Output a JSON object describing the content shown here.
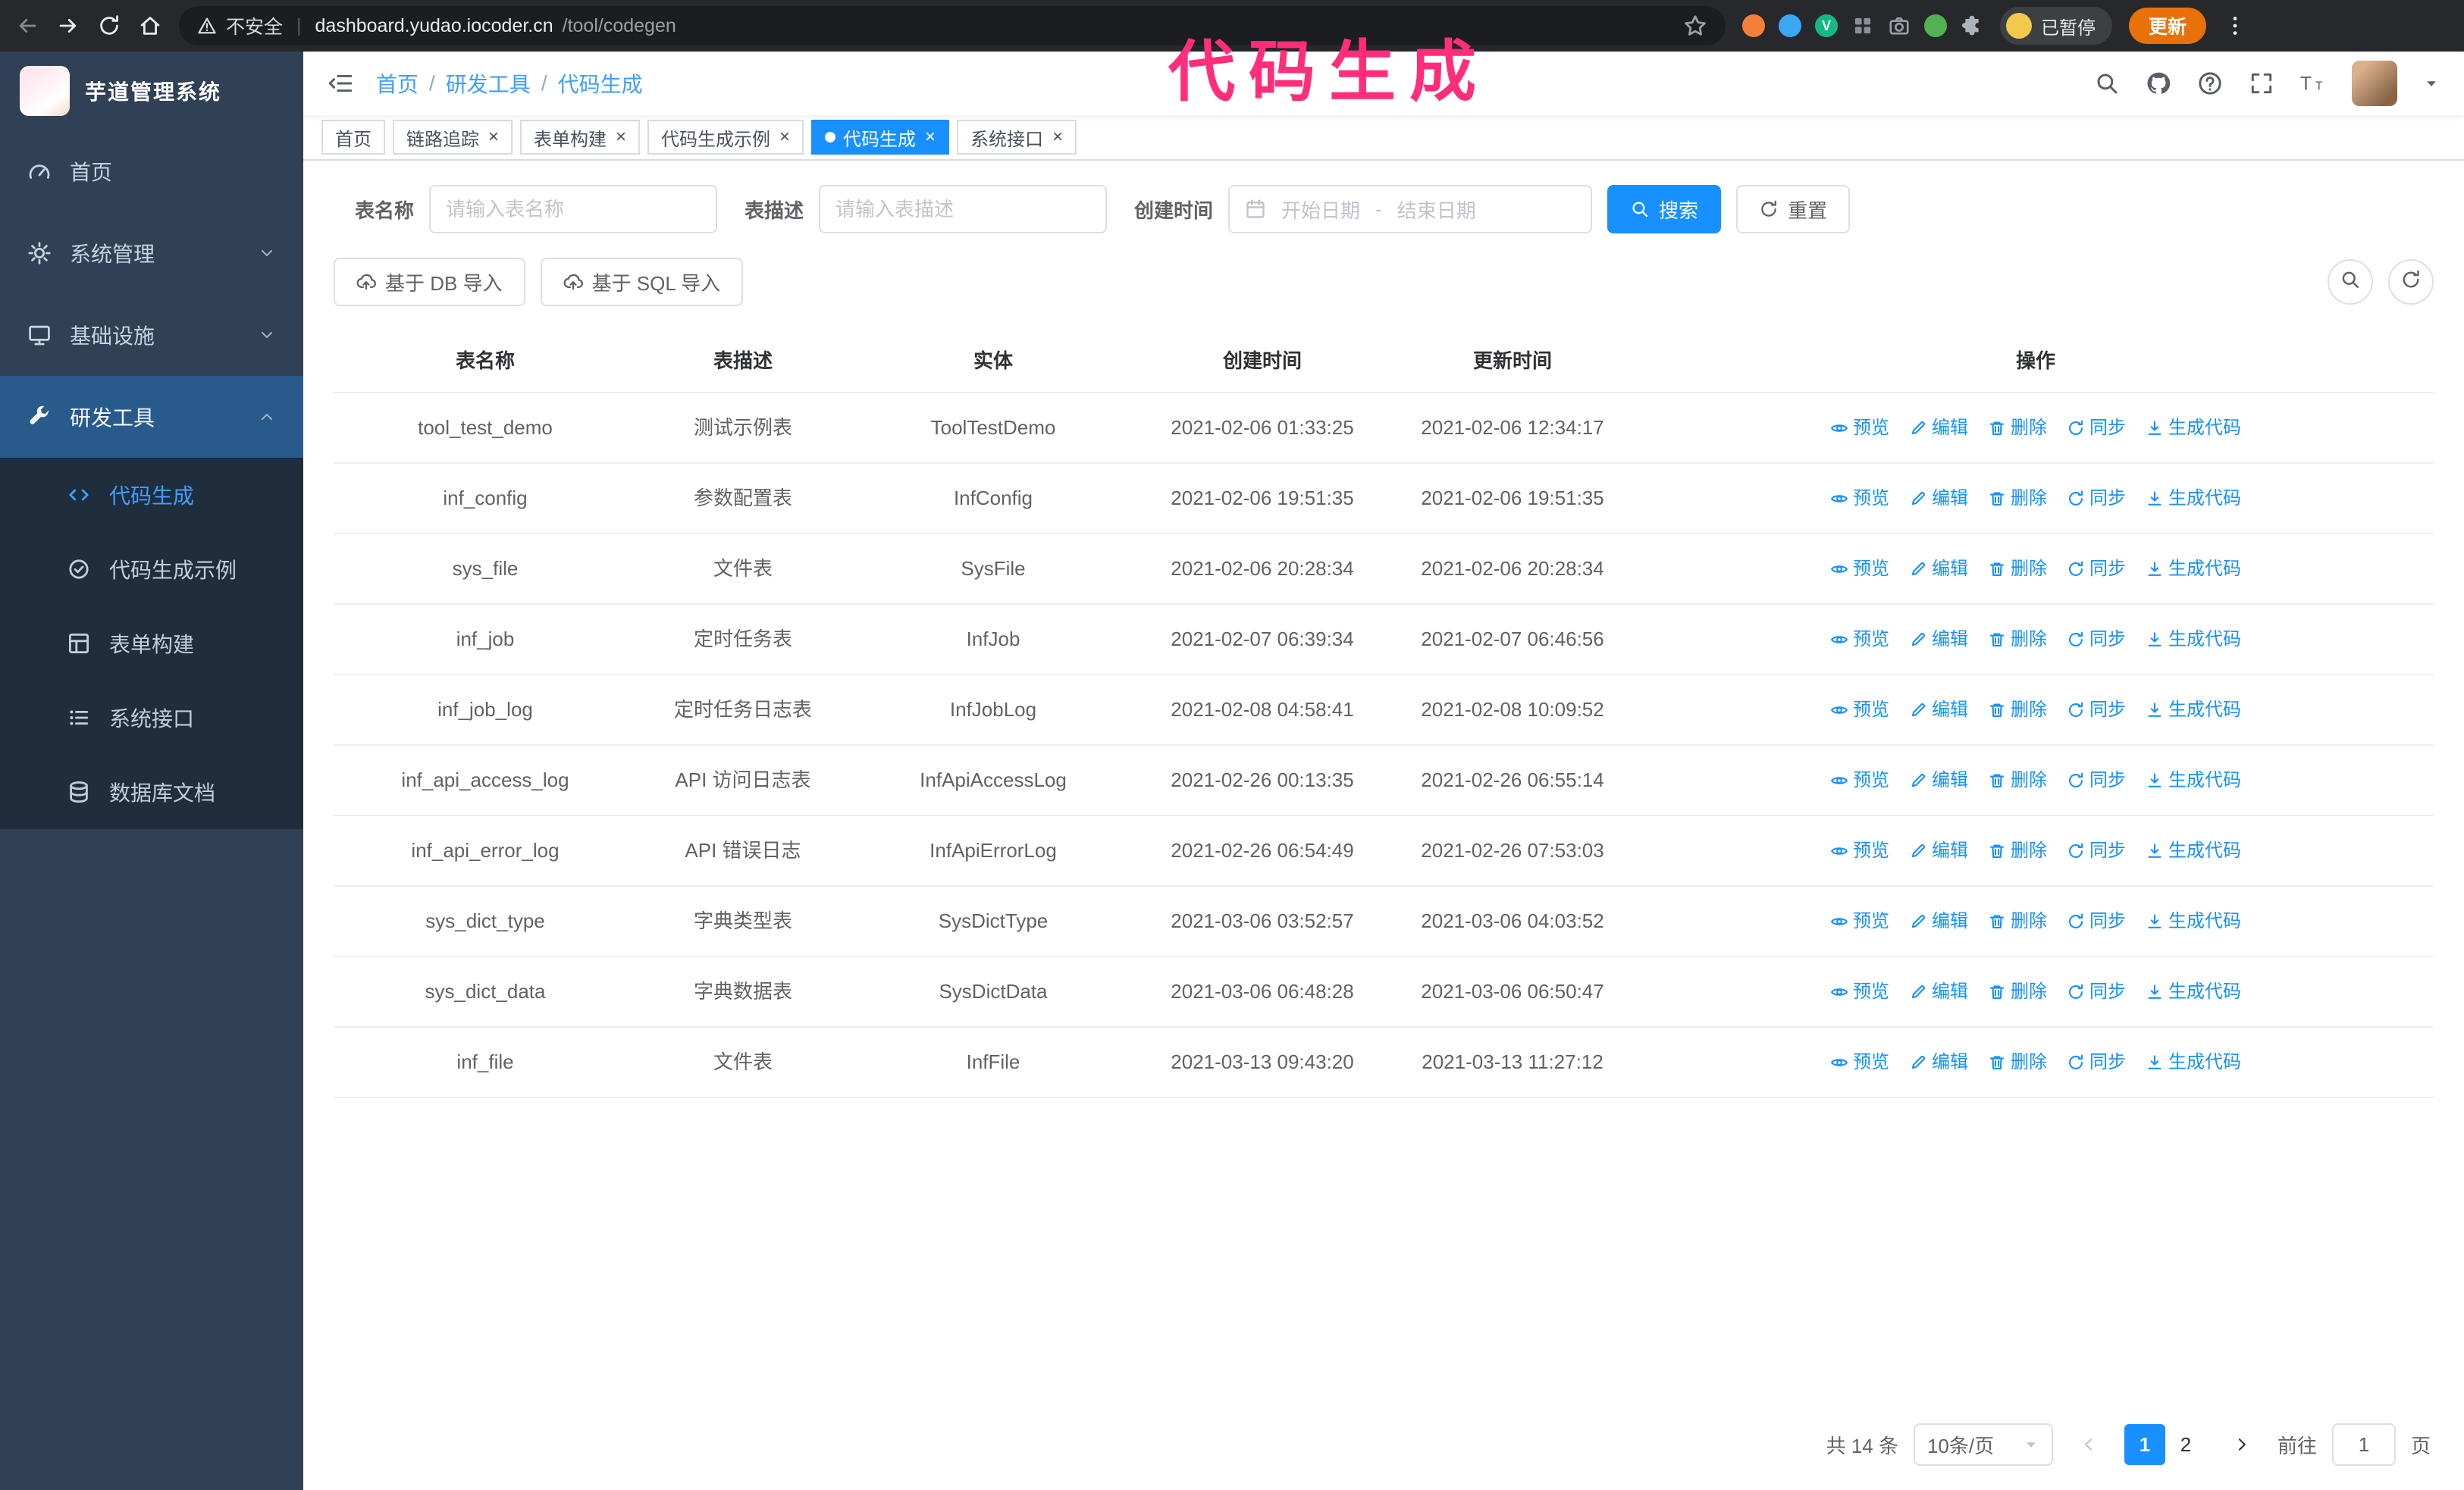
{
  "annotation": {
    "text": "代码生成",
    "color": "#ff2d7a"
  },
  "browser": {
    "security_label": "不安全",
    "url_host": "dashboard.yudao.iocoder.cn",
    "url_path": "/tool/codegen",
    "paused_badge": "已暂停",
    "update_label": "更新",
    "extensions": [
      {
        "id": "extension-1",
        "color": "#f5803a"
      },
      {
        "id": "extension-2",
        "color": "#3aa7f5"
      },
      {
        "id": "extension-3",
        "color": "#12b886",
        "letter": "V"
      },
      {
        "id": "extension-4",
        "glyph": "grid-icon",
        "color": "#8a9097"
      },
      {
        "id": "extension-5",
        "glyph": "camera-icon",
        "color": "#9aa0a6"
      },
      {
        "id": "extension-6",
        "color": "#52b153"
      },
      {
        "id": "extension-7",
        "glyph": "puzzle-icon",
        "color": "#aeb3b9"
      }
    ]
  },
  "colors": {
    "accent": "#1890ff",
    "sidebar_bg": "#304156",
    "submenu_bg": "#1f2d3d",
    "annotation": "#ff2d7a",
    "update_button": "#e8710a",
    "link": "#409eff"
  },
  "sidebar": {
    "logo_title": "芋道管理系统",
    "menu": [
      {
        "id": "home",
        "label": "首页",
        "icon": "dashboard-icon"
      },
      {
        "id": "system",
        "label": "系统管理",
        "icon": "gear-icon",
        "chevron": "down"
      },
      {
        "id": "infra",
        "label": "基础设施",
        "icon": "monitor-icon",
        "chevron": "down"
      },
      {
        "id": "devtools",
        "label": "研发工具",
        "icon": "tools-icon",
        "chevron": "up",
        "active": true,
        "open": true
      }
    ],
    "submenu": [
      {
        "id": "codegen",
        "label": "代码生成",
        "icon": "code-icon",
        "active": true
      },
      {
        "id": "codegen-example",
        "label": "代码生成示例",
        "icon": "example-icon"
      },
      {
        "id": "form-builder",
        "label": "表单构建",
        "icon": "form-icon"
      },
      {
        "id": "api",
        "label": "系统接口",
        "icon": "api-icon"
      },
      {
        "id": "db-doc",
        "label": "数据库文档",
        "icon": "database-icon"
      }
    ]
  },
  "navbar": {
    "breadcrumb": [
      "首页",
      "研发工具",
      "代码生成"
    ]
  },
  "tabs": [
    {
      "id": "home",
      "label": "首页",
      "closable": false,
      "active": false
    },
    {
      "id": "tracer",
      "label": "链路追踪",
      "closable": true,
      "active": false
    },
    {
      "id": "form-builder",
      "label": "表单构建",
      "closable": true,
      "active": false
    },
    {
      "id": "codegen-example",
      "label": "代码生成示例",
      "closable": true,
      "active": false
    },
    {
      "id": "codegen",
      "label": "代码生成",
      "closable": true,
      "active": true
    },
    {
      "id": "api",
      "label": "系统接口",
      "closable": true,
      "active": false
    }
  ],
  "filters": {
    "table_name_label": "表名称",
    "table_name_placeholder": "请输入表名称",
    "table_desc_label": "表描述",
    "table_desc_placeholder": "请输入表描述",
    "create_time_label": "创建时间",
    "date_start_placeholder": "开始日期",
    "date_separator": "-",
    "date_end_placeholder": "结束日期",
    "search_label": "搜索",
    "reset_label": "重置"
  },
  "toolbar": {
    "import_db_label": "基于 DB 导入",
    "import_sql_label": "基于 SQL 导入"
  },
  "table": {
    "columns": [
      "表名称",
      "表描述",
      "实体",
      "创建时间",
      "更新时间",
      "操作"
    ],
    "actions": [
      {
        "id": "preview",
        "label": "预览",
        "icon": "eye-icon"
      },
      {
        "id": "edit",
        "label": "编辑",
        "icon": "edit-icon"
      },
      {
        "id": "delete",
        "label": "删除",
        "icon": "delete-icon"
      },
      {
        "id": "sync",
        "label": "同步",
        "icon": "sync-icon"
      },
      {
        "id": "generate",
        "label": "生成代码",
        "icon": "download-icon"
      }
    ],
    "rows": [
      {
        "name": "tool_test_demo",
        "desc": "测试示例表",
        "entity": "ToolTestDemo",
        "created": "2021-02-06 01:33:25",
        "updated": "2021-02-06 12:34:17"
      },
      {
        "name": "inf_config",
        "desc": "参数配置表",
        "entity": "InfConfig",
        "created": "2021-02-06 19:51:35",
        "updated": "2021-02-06 19:51:35"
      },
      {
        "name": "sys_file",
        "desc": "文件表",
        "entity": "SysFile",
        "created": "2021-02-06 20:28:34",
        "updated": "2021-02-06 20:28:34"
      },
      {
        "name": "inf_job",
        "desc": "定时任务表",
        "entity": "InfJob",
        "created": "2021-02-07 06:39:34",
        "updated": "2021-02-07 06:46:56"
      },
      {
        "name": "inf_job_log",
        "desc": "定时任务日志表",
        "entity": "InfJobLog",
        "created": "2021-02-08 04:58:41",
        "updated": "2021-02-08 10:09:52"
      },
      {
        "name": "inf_api_access_log",
        "desc": "API 访问日志表",
        "entity": "InfApiAccessLog",
        "created": "2021-02-26 00:13:35",
        "updated": "2021-02-26 06:55:14"
      },
      {
        "name": "inf_api_error_log",
        "desc": "API 错误日志",
        "entity": "InfApiErrorLog",
        "created": "2021-02-26 06:54:49",
        "updated": "2021-02-26 07:53:03"
      },
      {
        "name": "sys_dict_type",
        "desc": "字典类型表",
        "entity": "SysDictType",
        "created": "2021-03-06 03:52:57",
        "updated": "2021-03-06 04:03:52"
      },
      {
        "name": "sys_dict_data",
        "desc": "字典数据表",
        "entity": "SysDictData",
        "created": "2021-03-06 06:48:28",
        "updated": "2021-03-06 06:50:47"
      },
      {
        "name": "inf_file",
        "desc": "文件表",
        "entity": "InfFile",
        "created": "2021-03-13 09:43:20",
        "updated": "2021-03-13 11:27:12"
      }
    ]
  },
  "pagination": {
    "total": "共 14 条",
    "page_size": "10条/页",
    "pages": [
      {
        "label": "1",
        "active": true
      },
      {
        "label": "2",
        "active": false
      }
    ],
    "goto_label": "前往",
    "goto_value": "1",
    "goto_suffix": "页"
  }
}
